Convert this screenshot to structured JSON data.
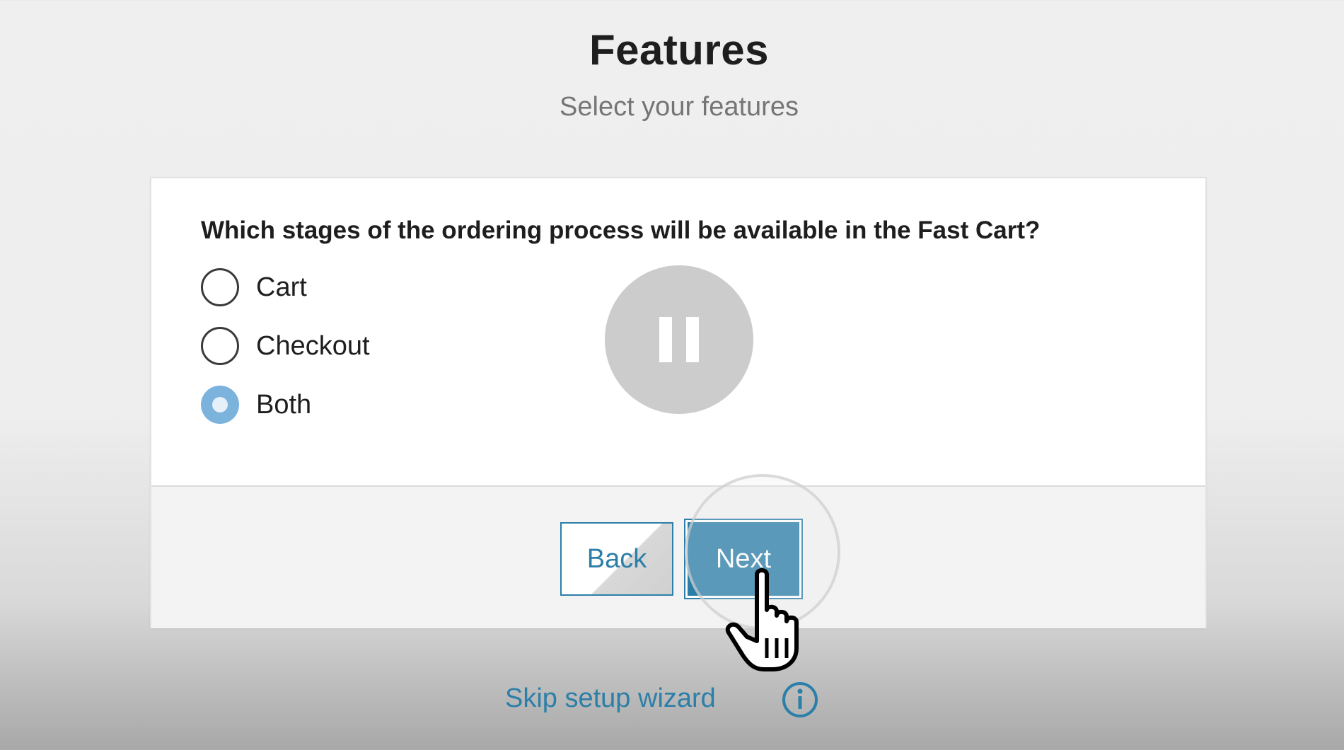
{
  "header": {
    "title": "Features",
    "subtitle": "Select your features"
  },
  "question": {
    "text": "Which stages of the ordering process will be available in the Fast Cart?",
    "options": [
      {
        "label": "Cart",
        "selected": false
      },
      {
        "label": "Checkout",
        "selected": false
      },
      {
        "label": "Both",
        "selected": true
      }
    ]
  },
  "footer": {
    "back_label": "Back",
    "next_label": "Next"
  },
  "skip": {
    "label": "Skip setup wizard"
  },
  "icons": {
    "pause": "pause-icon",
    "info": "info-icon",
    "cursor": "hand-pointer-cursor"
  },
  "colors": {
    "accent": "#2a7ea8",
    "radio_selected": "#7cb3dd"
  }
}
